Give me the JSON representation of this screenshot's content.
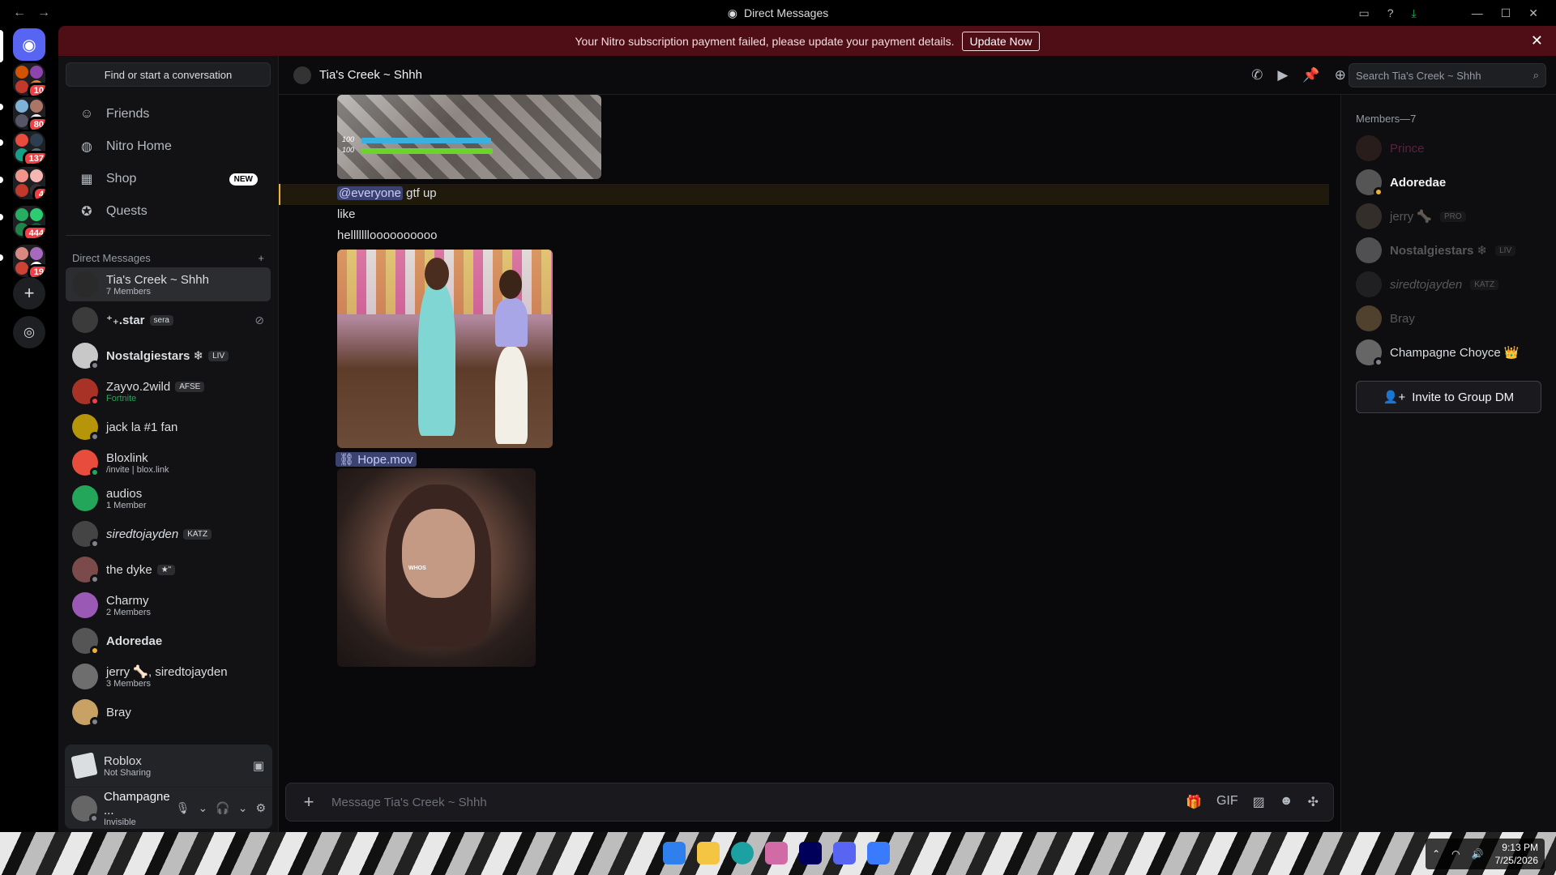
{
  "window": {
    "title": "Direct Messages"
  },
  "banner": {
    "text": "Your Nitro subscription payment failed, please update your payment details.",
    "button": "Update Now"
  },
  "rail": {
    "badges": [
      "10",
      "80",
      "137",
      "4",
      "444",
      "19"
    ]
  },
  "sidebar": {
    "find_placeholder": "Find or start a conversation",
    "nav": [
      {
        "label": "Friends",
        "icon": "friends-icon"
      },
      {
        "label": "Nitro Home",
        "icon": "nitro-icon"
      },
      {
        "label": "Shop",
        "icon": "shop-icon",
        "badge": "NEW"
      },
      {
        "label": "Quests",
        "icon": "quests-icon"
      }
    ],
    "dm_header": "Direct Messages",
    "dms": [
      {
        "name": "Tia's Creek ~ Shhh",
        "sub": "7 Members",
        "active": true
      },
      {
        "name": "⁺₊.star",
        "tag": "sera"
      },
      {
        "name": "Nostalgiestars ❄",
        "tag": "LIV"
      },
      {
        "name": "Zayvo.2wild",
        "tag": "AFSE",
        "sub": "Fortnite"
      },
      {
        "name": "jack la #1 fan"
      },
      {
        "name": "Bloxlink",
        "sub": "/invite | blox.link"
      },
      {
        "name": "audios",
        "sub": "1 Member"
      },
      {
        "name": "siredtojayden",
        "tag": "KATZ"
      },
      {
        "name": "the dyke",
        "tag": "★\""
      },
      {
        "name": "Charmy",
        "sub": "2 Members"
      },
      {
        "name": "Adoredae"
      },
      {
        "name": "jerry 🦴, siredtojayden",
        "sub": "3 Members"
      },
      {
        "name": "Bray"
      }
    ],
    "activity": {
      "title": "Roblox",
      "sub": "Not Sharing"
    },
    "user": {
      "name": "Champagne ...",
      "status": "Invisible"
    }
  },
  "chat": {
    "title": "Tia's Creek ~ Shhh",
    "search_placeholder": "Search Tia's Creek ~ Shhh",
    "game_hud": {
      "top": "100",
      "bottom": "100"
    },
    "messages": {
      "mention": "@everyone",
      "line1_rest": " gtf up",
      "line2": "like",
      "line3": "hellllllloooooooooo",
      "attachment": "Hope.mov",
      "caption": "WHOS"
    },
    "composer_placeholder": "Message Tia's Creek ~ Shhh"
  },
  "members": {
    "header": "Members—7",
    "list": [
      {
        "name": "Prince",
        "dim": true,
        "color": "#e84393"
      },
      {
        "name": "Adoredae",
        "dim": false,
        "color": "#f2f3f5"
      },
      {
        "name": "jerry 🦴",
        "tag": "PRO",
        "dim": true,
        "color": "#dbdee1"
      },
      {
        "name": "Nostalgiestars ❄",
        "tag": "LIV",
        "dim": true,
        "color": "#dbdee1"
      },
      {
        "name": "siredtojayden",
        "tag": "KATZ",
        "dim": true,
        "color": "#dbdee1"
      },
      {
        "name": "Bray",
        "dim": true,
        "color": "#dbdee1"
      },
      {
        "name": "Champagne Choyce 👑",
        "dim": false,
        "color": "#dbdee1"
      }
    ],
    "invite": "Invite to Group DM"
  },
  "taskbar": {
    "time": "9:13 PM",
    "date": "7/25/2026"
  }
}
